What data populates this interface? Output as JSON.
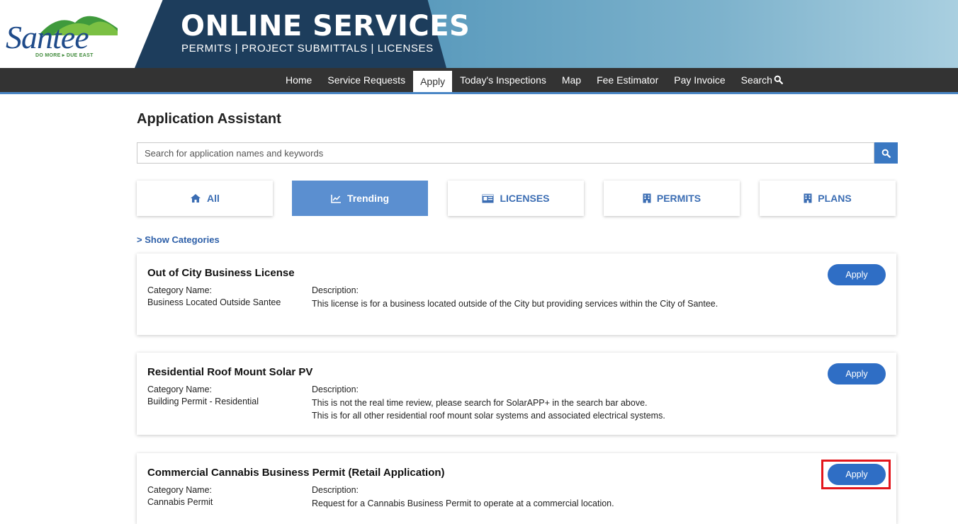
{
  "logo": {
    "word": "Santee",
    "tagline": "DO MORE ▸ DUE EAST"
  },
  "banner": {
    "title": "ONLINE SERVICES",
    "subtitle": "PERMITS | PROJECT SUBMITTALS | LICENSES"
  },
  "nav": {
    "items": [
      "Home",
      "Service Requests",
      "Apply",
      "Today's Inspections",
      "Map",
      "Fee Estimator",
      "Pay Invoice",
      "Search"
    ],
    "active": "Apply",
    "search_icon": "search-icon"
  },
  "page": {
    "title": "Application Assistant"
  },
  "search": {
    "placeholder": "Search for application names and keywords",
    "value": ""
  },
  "tabs": [
    {
      "label": "All",
      "icon": "home-icon",
      "active": false
    },
    {
      "label": "Trending",
      "icon": "trending-chart-icon",
      "active": true
    },
    {
      "label": "LICENSES",
      "icon": "id-card-icon",
      "active": false
    },
    {
      "label": "PERMITS",
      "icon": "building-icon",
      "active": false
    },
    {
      "label": "PLANS",
      "icon": "building-icon",
      "active": false
    }
  ],
  "show_categories": "> Show Categories",
  "labels": {
    "category": "Category Name:",
    "description": "Description:",
    "apply": "Apply"
  },
  "cards": [
    {
      "title": "Out of City Business License",
      "category": "Business Located Outside Santee",
      "description": "This license is for a business located outside of the City but providing services within the City of Santee."
    },
    {
      "title": "Residential Roof Mount Solar PV",
      "category": "Building Permit - Residential",
      "description_lines": [
        "This is not the real time review, please search for SolarAPP+ in the search bar above.",
        "This is for all other residential roof mount solar systems and associated electrical systems."
      ]
    },
    {
      "title": "Commercial Cannabis Business Permit (Retail Application)",
      "category": "Cannabis Permit",
      "description": "Request for a Cannabis Business Permit to operate at a commercial location.",
      "highlighted": true
    }
  ],
  "colors": {
    "nav_bg": "#333333",
    "accent": "#2f6ec5",
    "tab_active": "#5b8fd0",
    "banner_dark": "#1d3d5c",
    "highlight": "#e3161c"
  }
}
